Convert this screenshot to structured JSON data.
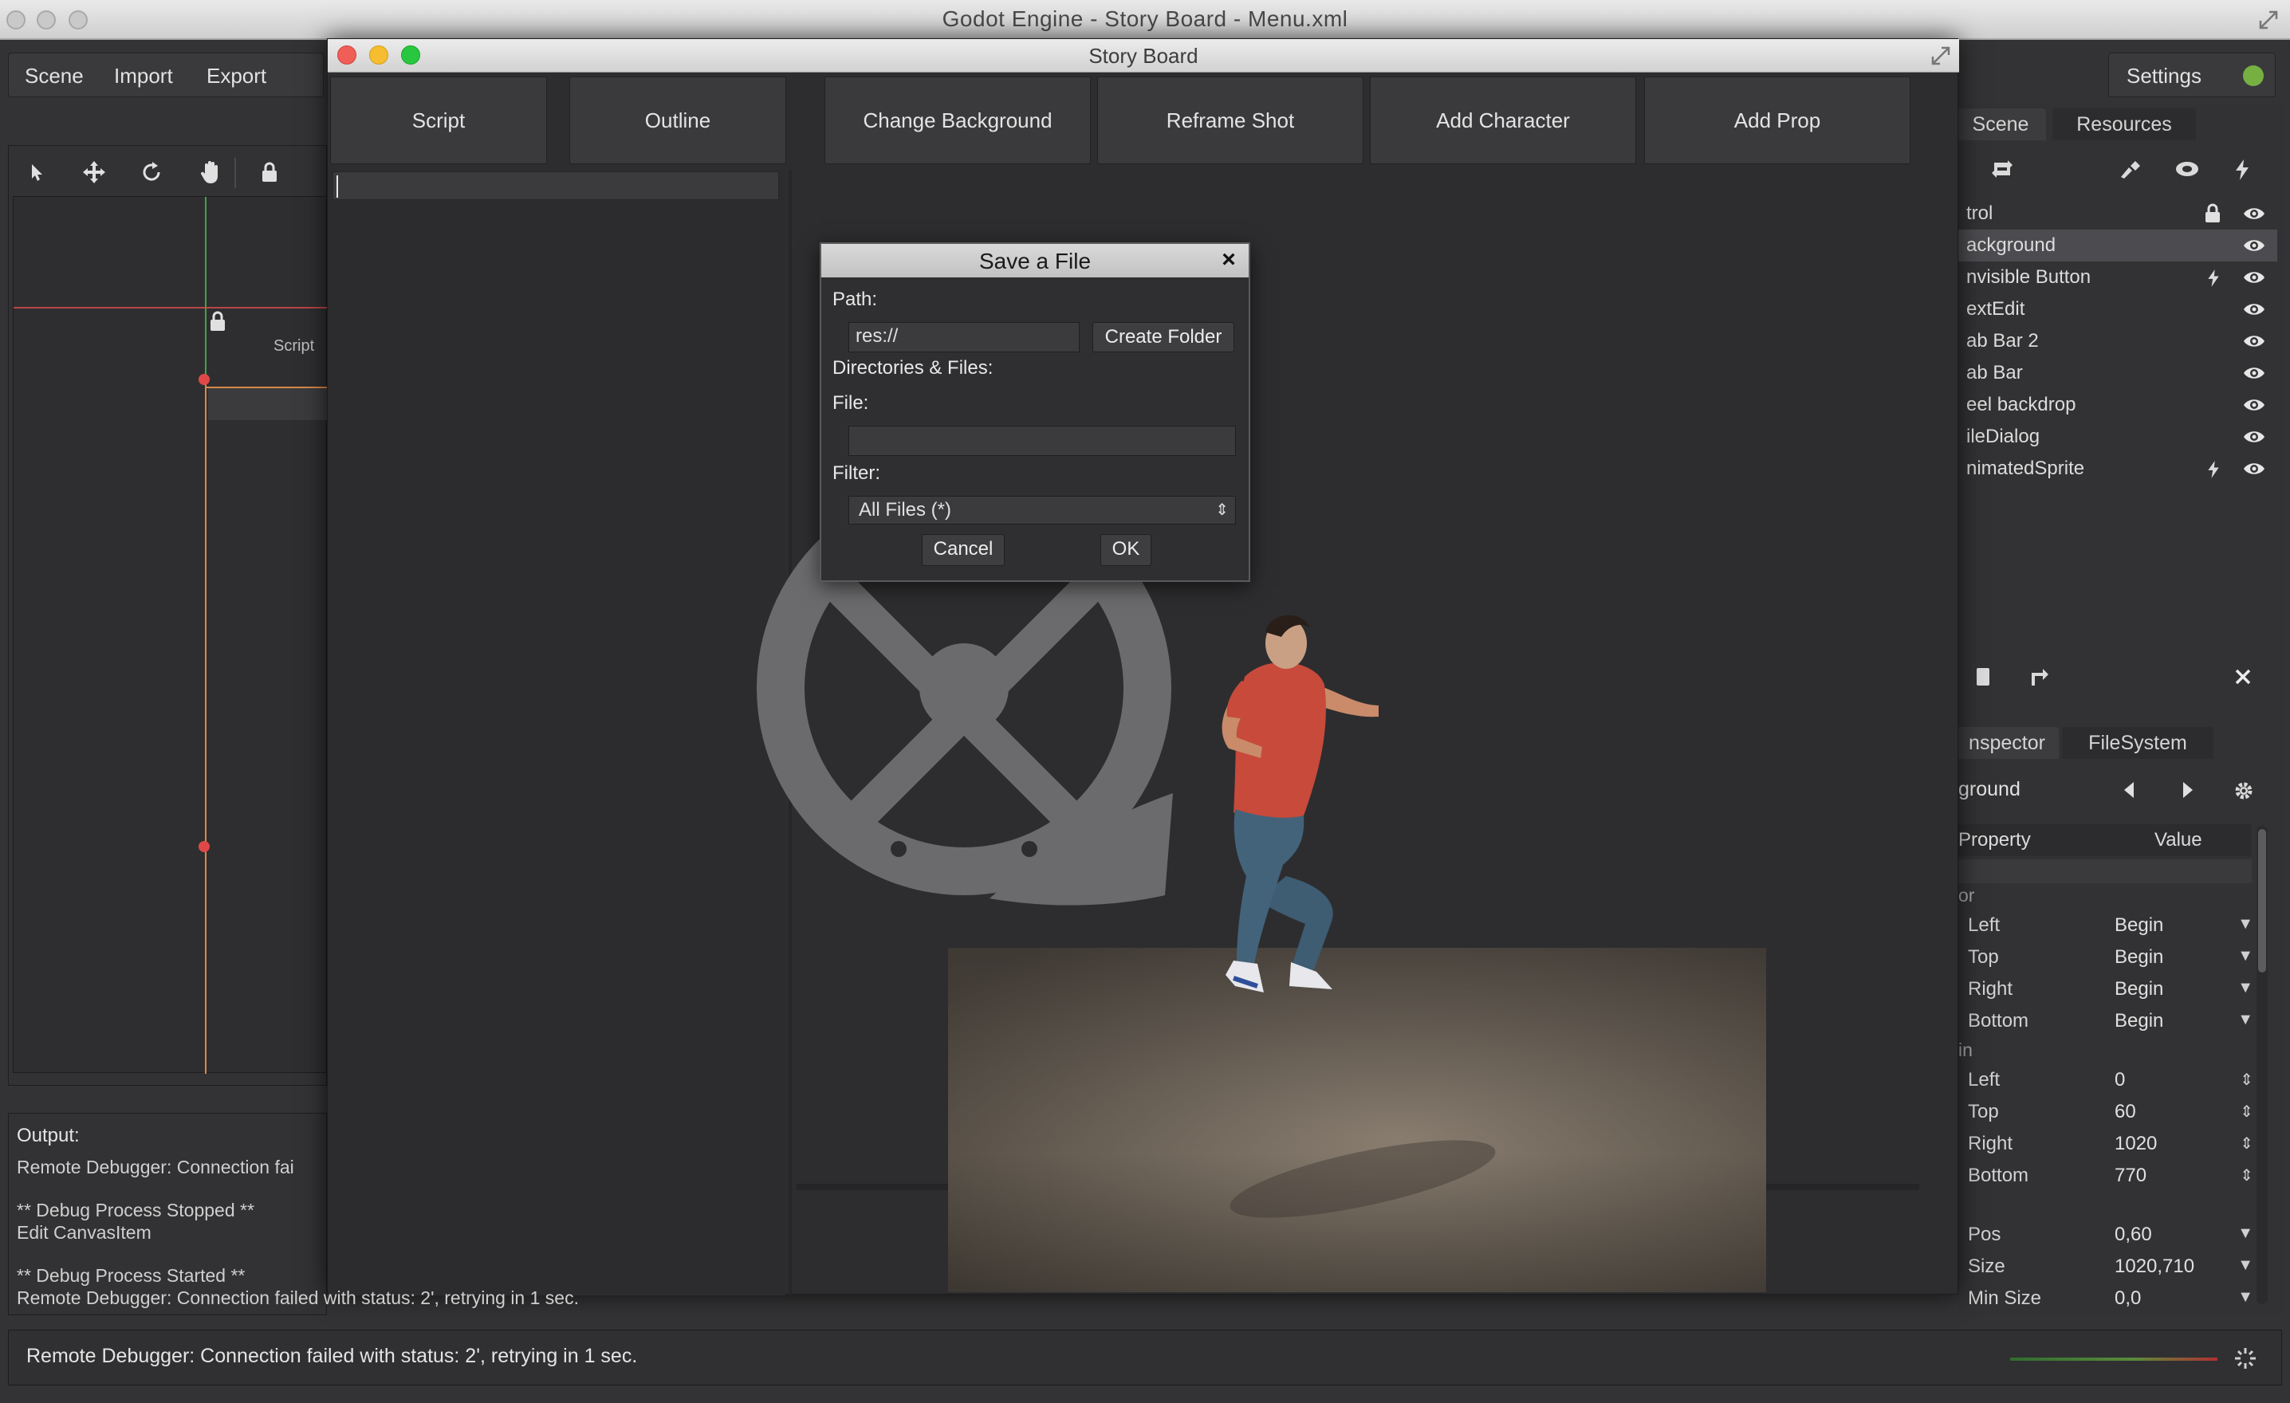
{
  "window": {
    "title": "Godot Engine - Story Board - Menu.xml"
  },
  "menu": {
    "scene": "Scene",
    "import": "Import",
    "export": "Export",
    "settings": "Settings"
  },
  "viewport": {
    "label": "Script"
  },
  "output": {
    "header": "Output:",
    "lines": [
      "Remote Debugger: Connection fai",
      "",
      "** Debug Process Stopped **",
      "Edit CanvasItem",
      "",
      "** Debug Process Started **",
      "Remote Debugger: Connection failed with status: 2', retrying in 1 sec."
    ]
  },
  "status": {
    "message": "Remote Debugger: Connection failed with status: 2', retrying in 1 sec."
  },
  "storyboard": {
    "title": "Story Board",
    "buttons": [
      "Script",
      "Outline",
      "Change Background",
      "Reframe Shot",
      "Add Character",
      "Add Prop"
    ]
  },
  "save_dialog": {
    "title": "Save a File",
    "path_label": "Path:",
    "path_value": "res://",
    "create_folder": "Create Folder",
    "dirs_label": "Directories & Files:",
    "file_label": "File:",
    "file_value": "",
    "filter_label": "Filter:",
    "filter_value": "All Files (*)",
    "cancel": "Cancel",
    "ok": "OK"
  },
  "scene_dock": {
    "tabs": [
      "Scene",
      "Resources"
    ],
    "items": [
      {
        "name": "trol",
        "lock": true,
        "script": false
      },
      {
        "name": "ackground",
        "lock": false,
        "script": false,
        "selected": true
      },
      {
        "name": "nvisible Button",
        "lock": false,
        "script": true
      },
      {
        "name": "extEdit",
        "lock": false,
        "script": false
      },
      {
        "name": "ab Bar 2",
        "lock": false,
        "script": false
      },
      {
        "name": "ab Bar",
        "lock": false,
        "script": false
      },
      {
        "name": "eel backdrop",
        "lock": false,
        "script": false
      },
      {
        "name": "ileDialog",
        "lock": false,
        "script": false
      },
      {
        "name": "nimatedSprite",
        "lock": false,
        "script": true
      }
    ]
  },
  "inspector": {
    "tabs": [
      "nspector",
      "FileSystem"
    ],
    "object": "ground",
    "col_property": "Property",
    "col_value": "Value",
    "section_anchor": "or",
    "anchor": [
      {
        "name": "Left",
        "value": "Begin"
      },
      {
        "name": "Top",
        "value": "Begin"
      },
      {
        "name": "Right",
        "value": "Begin"
      },
      {
        "name": "Bottom",
        "value": "Begin"
      }
    ],
    "section_margin": "in",
    "margin": [
      {
        "name": "Left",
        "value": "0"
      },
      {
        "name": "Top",
        "value": "60"
      },
      {
        "name": "Right",
        "value": "1020"
      },
      {
        "name": "Bottom",
        "value": "770"
      }
    ],
    "rect": [
      {
        "name": "Pos",
        "value": "0,60"
      },
      {
        "name": "Size",
        "value": "1020,710"
      },
      {
        "name": "Min Size",
        "value": "0,0"
      }
    ]
  },
  "colors": {
    "accent_red": "#d94c4c",
    "guide_green": "#4cc04c",
    "guide_orange": "#d8894a",
    "settings_dot": "#76b043"
  }
}
